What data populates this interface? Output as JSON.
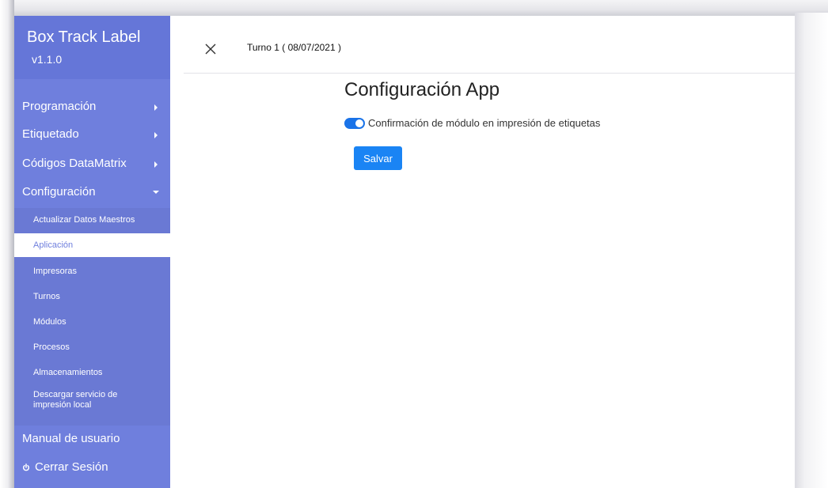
{
  "brand": {
    "name": "Box Track Label",
    "version": "v1.1.0"
  },
  "sidebar": {
    "items": [
      {
        "label": "Programación",
        "icon": "caret-right-icon"
      },
      {
        "label": "Etiquetado",
        "icon": "caret-right-icon"
      },
      {
        "label": "Códigos DataMatrix",
        "icon": "caret-right-icon"
      },
      {
        "label": "Configuración",
        "icon": "caret-down-icon"
      }
    ],
    "submenu": [
      {
        "label": "Actualizar Datos Maestros"
      },
      {
        "label": "Aplicación",
        "active": true
      },
      {
        "label": "Impresoras"
      },
      {
        "label": "Turnos"
      },
      {
        "label": "Módulos"
      },
      {
        "label": "Procesos"
      },
      {
        "label": "Almacenamientos"
      },
      {
        "line1": "Descargar servicio de",
        "line2": "impresión local"
      }
    ],
    "manual": "Manual de usuario",
    "logout": "Cerrar Sesión"
  },
  "topbar": {
    "shift": "Turno 1 ( 08/07/2021 )"
  },
  "main": {
    "title": "Configuración App",
    "toggle_label": "Confirmación de módulo en impresión de etiquetas",
    "toggle_on": true,
    "save_label": "Salvar"
  },
  "colors": {
    "sidebar": "#6f7fdd",
    "brand_bg": "#6576d8",
    "accent": "#1a84f4"
  }
}
